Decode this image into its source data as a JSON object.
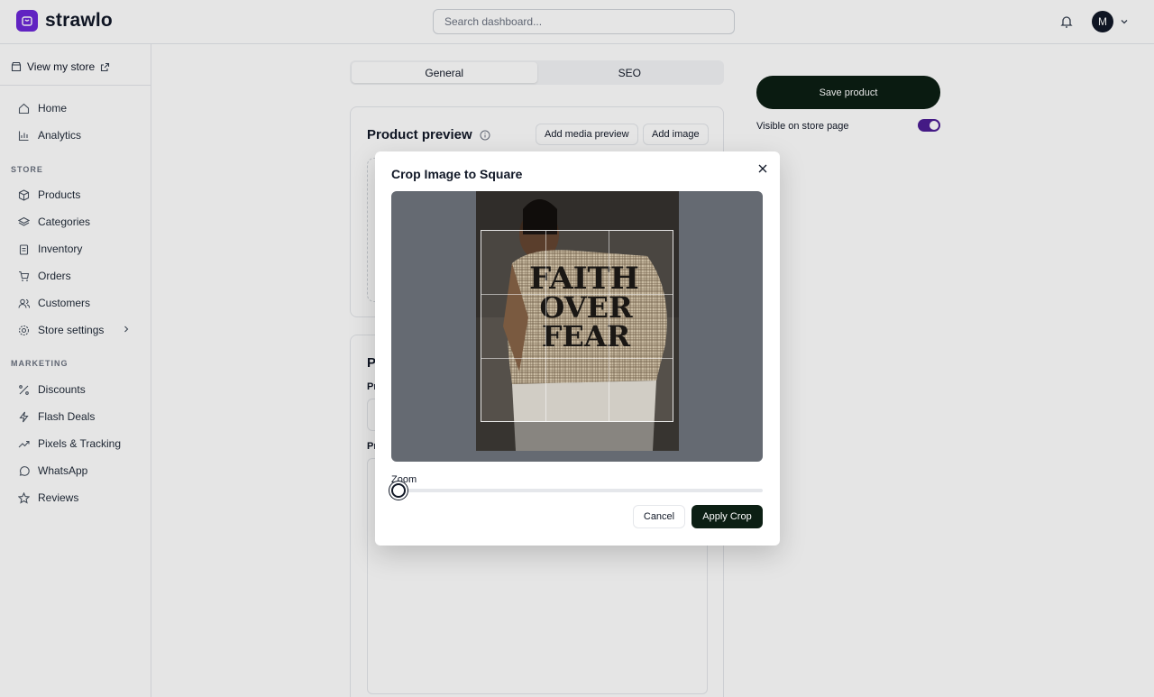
{
  "header": {
    "logo_text": "strawlo",
    "search_placeholder": "Search dashboard...",
    "avatar_initial": "M"
  },
  "sidebar": {
    "view_store": "View my store",
    "items_top": [
      {
        "label": "Home",
        "icon": "home-icon"
      },
      {
        "label": "Analytics",
        "icon": "chart-icon"
      }
    ],
    "store_heading": "STORE",
    "items_store": [
      {
        "label": "Products",
        "icon": "box-icon"
      },
      {
        "label": "Categories",
        "icon": "layers-icon"
      },
      {
        "label": "Inventory",
        "icon": "clipboard-icon"
      },
      {
        "label": "Orders",
        "icon": "cart-icon"
      },
      {
        "label": "Customers",
        "icon": "users-icon"
      },
      {
        "label": "Store settings",
        "icon": "gear-icon"
      }
    ],
    "marketing_heading": "MARKETING",
    "items_marketing": [
      {
        "label": "Discounts",
        "icon": "percent-icon"
      },
      {
        "label": "Flash Deals",
        "icon": "bolt-icon"
      },
      {
        "label": "Pixels & Tracking",
        "icon": "trend-icon"
      },
      {
        "label": "WhatsApp",
        "icon": "chat-icon"
      },
      {
        "label": "Reviews",
        "icon": "star-icon"
      }
    ]
  },
  "main": {
    "tabs": [
      {
        "label": "General",
        "active": true
      },
      {
        "label": "SEO",
        "active": false
      }
    ],
    "preview_card": {
      "title": "Product preview",
      "add_media_label": "Add media preview",
      "add_image_label": "Add image"
    },
    "details_card": {
      "title_partial": "P",
      "field1_partial": "Pr",
      "field2_partial": "Pr"
    },
    "side_panel": {
      "save_label": "Save product",
      "visible_label": "Visible on store page",
      "visible": true
    }
  },
  "modal": {
    "title": "Crop Image to Square",
    "zoom_label": "Zoom",
    "zoom_value": 0,
    "cancel_label": "Cancel",
    "apply_label": "Apply Crop",
    "image_text": [
      "FAITH",
      "OVER",
      "FEAR"
    ]
  },
  "colors": {
    "brand": "#6d28d9",
    "primary_button": "#0c1f14",
    "toggle_on": "#4c1d95"
  }
}
